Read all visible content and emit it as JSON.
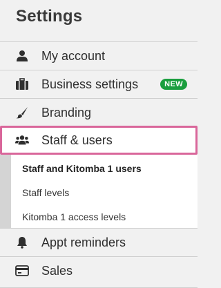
{
  "page": {
    "title": "Settings"
  },
  "menu": {
    "items": [
      {
        "label": "My account",
        "icon": "person-icon"
      },
      {
        "label": "Business settings",
        "icon": "briefcase-icon",
        "badge": "NEW"
      },
      {
        "label": "Branding",
        "icon": "paintbrush-icon"
      },
      {
        "label": "Staff & users",
        "icon": "users-icon",
        "active": true
      },
      {
        "label": "Appt reminders",
        "icon": "bell-icon"
      },
      {
        "label": "Sales",
        "icon": "credit-card-icon"
      }
    ],
    "submenu": [
      {
        "label": "Staff and Kitomba 1 users",
        "selected": true
      },
      {
        "label": "Staff levels"
      },
      {
        "label": "Kitomba 1 access levels"
      }
    ]
  },
  "colors": {
    "active_border": "#d9669a",
    "badge_bg": "#1a9e3e",
    "background": "#f1f1f1"
  }
}
